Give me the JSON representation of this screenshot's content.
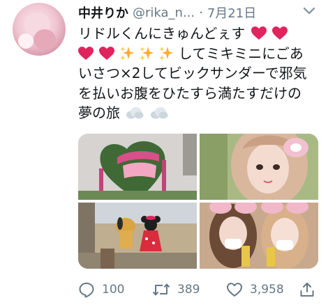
{
  "tweet": {
    "author_name": "中井りか",
    "handle": "@rika_n...",
    "separator": "·",
    "date": "7月21日",
    "text_lines": [
      "リドルくんにきゅんどぇす",
      "してミキミニにごあ",
      "いさつ×2してビックサンダーで邪気",
      "を払いお腹をひたすら満たすだけの",
      "夢の旅"
    ],
    "emoji": {
      "heart": "red-heart-emoji",
      "sparkles": "sparkles-emoji",
      "cloud": "cloud-emoji"
    },
    "media": [
      {
        "name": "photo-heart-topiary"
      },
      {
        "name": "photo-selfie-girl"
      },
      {
        "name": "photo-pluto-minnie"
      },
      {
        "name": "photo-two-girls-drinks"
      }
    ]
  },
  "actions": {
    "reply_count": "100",
    "retweet_count": "389",
    "like_count": "3,958",
    "icons": [
      "reply-icon",
      "retweet-icon",
      "like-icon",
      "share-icon"
    ]
  },
  "colors": {
    "text": "#14171a",
    "secondary": "#657786",
    "heart": "#e0245e",
    "sparkle": "#ffac33"
  }
}
